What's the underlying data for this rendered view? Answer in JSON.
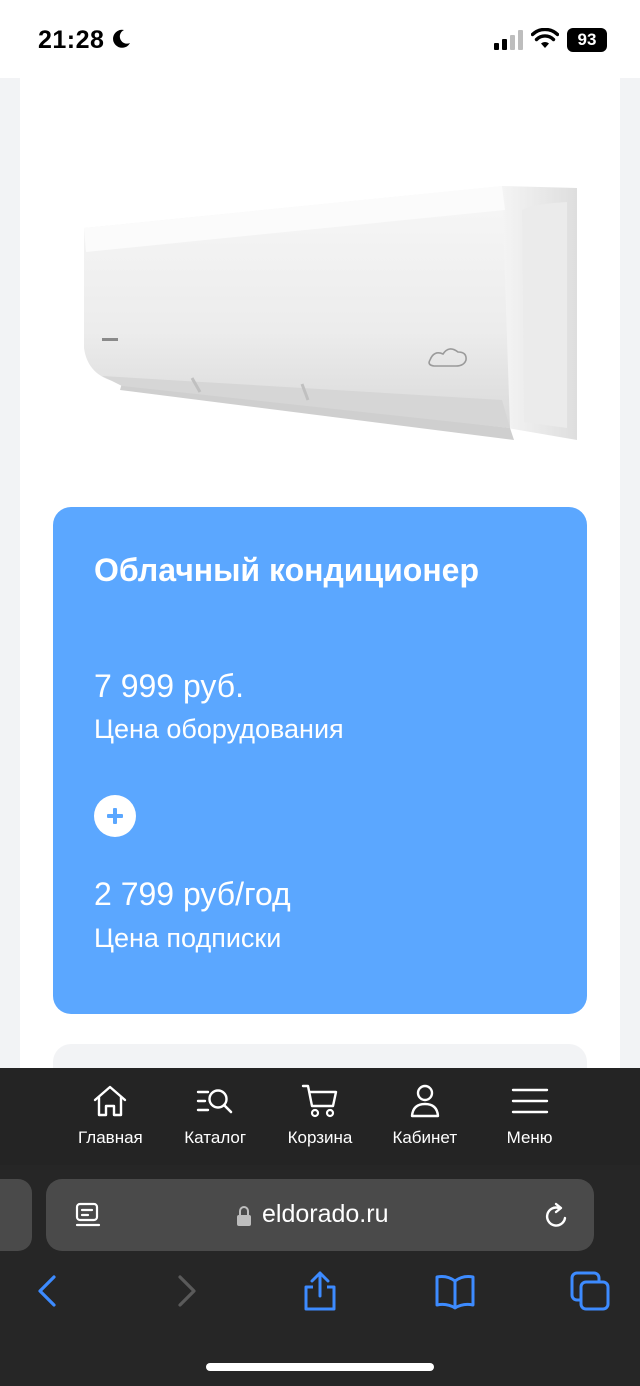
{
  "status_bar": {
    "time": "21:28",
    "battery": "93"
  },
  "product": {
    "title": "Облачный кондиционер",
    "price": "7 999 руб.",
    "price_caption": "Цена оборудования",
    "subscription_price": "2 799 руб/год",
    "subscription_caption": "Цена подписки",
    "card_color": "#5ba7ff"
  },
  "site_nav": {
    "items": [
      {
        "label": "Главная",
        "icon": "home-icon"
      },
      {
        "label": "Каталог",
        "icon": "catalog-search-icon"
      },
      {
        "label": "Корзина",
        "icon": "cart-icon"
      },
      {
        "label": "Кабинет",
        "icon": "user-icon"
      },
      {
        "label": "Меню",
        "icon": "menu-icon"
      }
    ]
  },
  "browser": {
    "url": "eldorado.ru",
    "accent": "#3d8bff"
  }
}
